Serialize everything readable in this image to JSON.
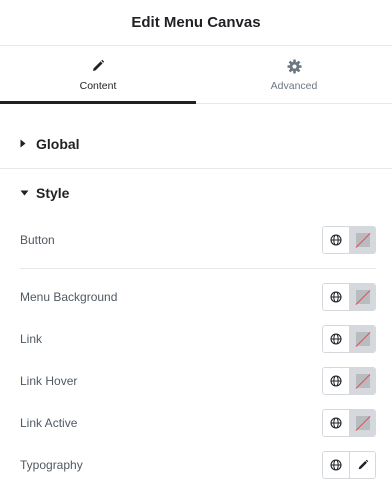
{
  "header": {
    "title": "Edit Menu Canvas"
  },
  "tabs": [
    {
      "label": "Content",
      "icon": "pencil-icon",
      "active": true
    },
    {
      "label": "Advanced",
      "icon": "gear-icon",
      "active": false
    }
  ],
  "sections": {
    "global": {
      "title": "Global",
      "expanded": false
    },
    "style": {
      "title": "Style",
      "expanded": true
    }
  },
  "style_rows": [
    {
      "label": "Button",
      "control": "color"
    },
    {
      "label": "Menu Background",
      "control": "color"
    },
    {
      "label": "Link",
      "control": "color"
    },
    {
      "label": "Link Hover",
      "control": "color"
    },
    {
      "label": "Link Active",
      "control": "color"
    },
    {
      "label": "Typography",
      "control": "edit"
    }
  ],
  "colors": {
    "accent": "#1f2124",
    "swatch_bg": "#d5d8dc",
    "none_slash": "#e04a56",
    "label": "#515962"
  }
}
